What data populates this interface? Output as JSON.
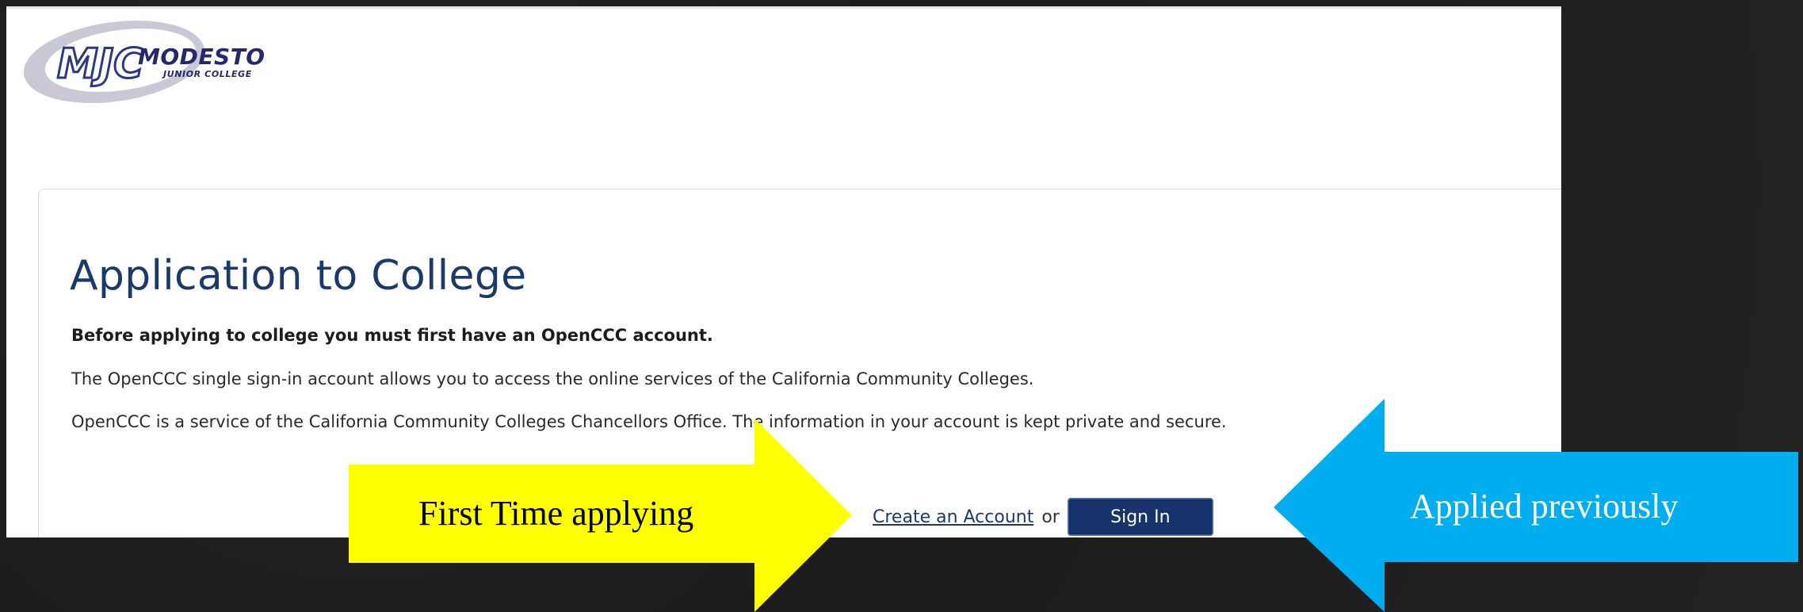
{
  "logo": {
    "initials": "MJC",
    "name": "MODESTO",
    "subtitle": "JUNIOR COLLEGE"
  },
  "page": {
    "title": "Application to College",
    "lead": "Before applying to college you must first have an OpenCCC account.",
    "paragraph1": "The OpenCCC single sign-in account allows you to access the online services of the California Community Colleges.",
    "paragraph2": "OpenCCC is a service of the California Community Colleges Chancellors Office. The information in your account is kept private and secure."
  },
  "actions": {
    "create_account": "Create an Account",
    "or": "or",
    "sign_in": "Sign In"
  },
  "callouts": {
    "first_time": "First Time applying",
    "applied_previously": "Applied previously"
  },
  "colors": {
    "title": "#1b3a6b",
    "sign_in_button": "#16336b",
    "yellow_arrow": "#ffff00",
    "blue_arrow": "#00aeef"
  }
}
